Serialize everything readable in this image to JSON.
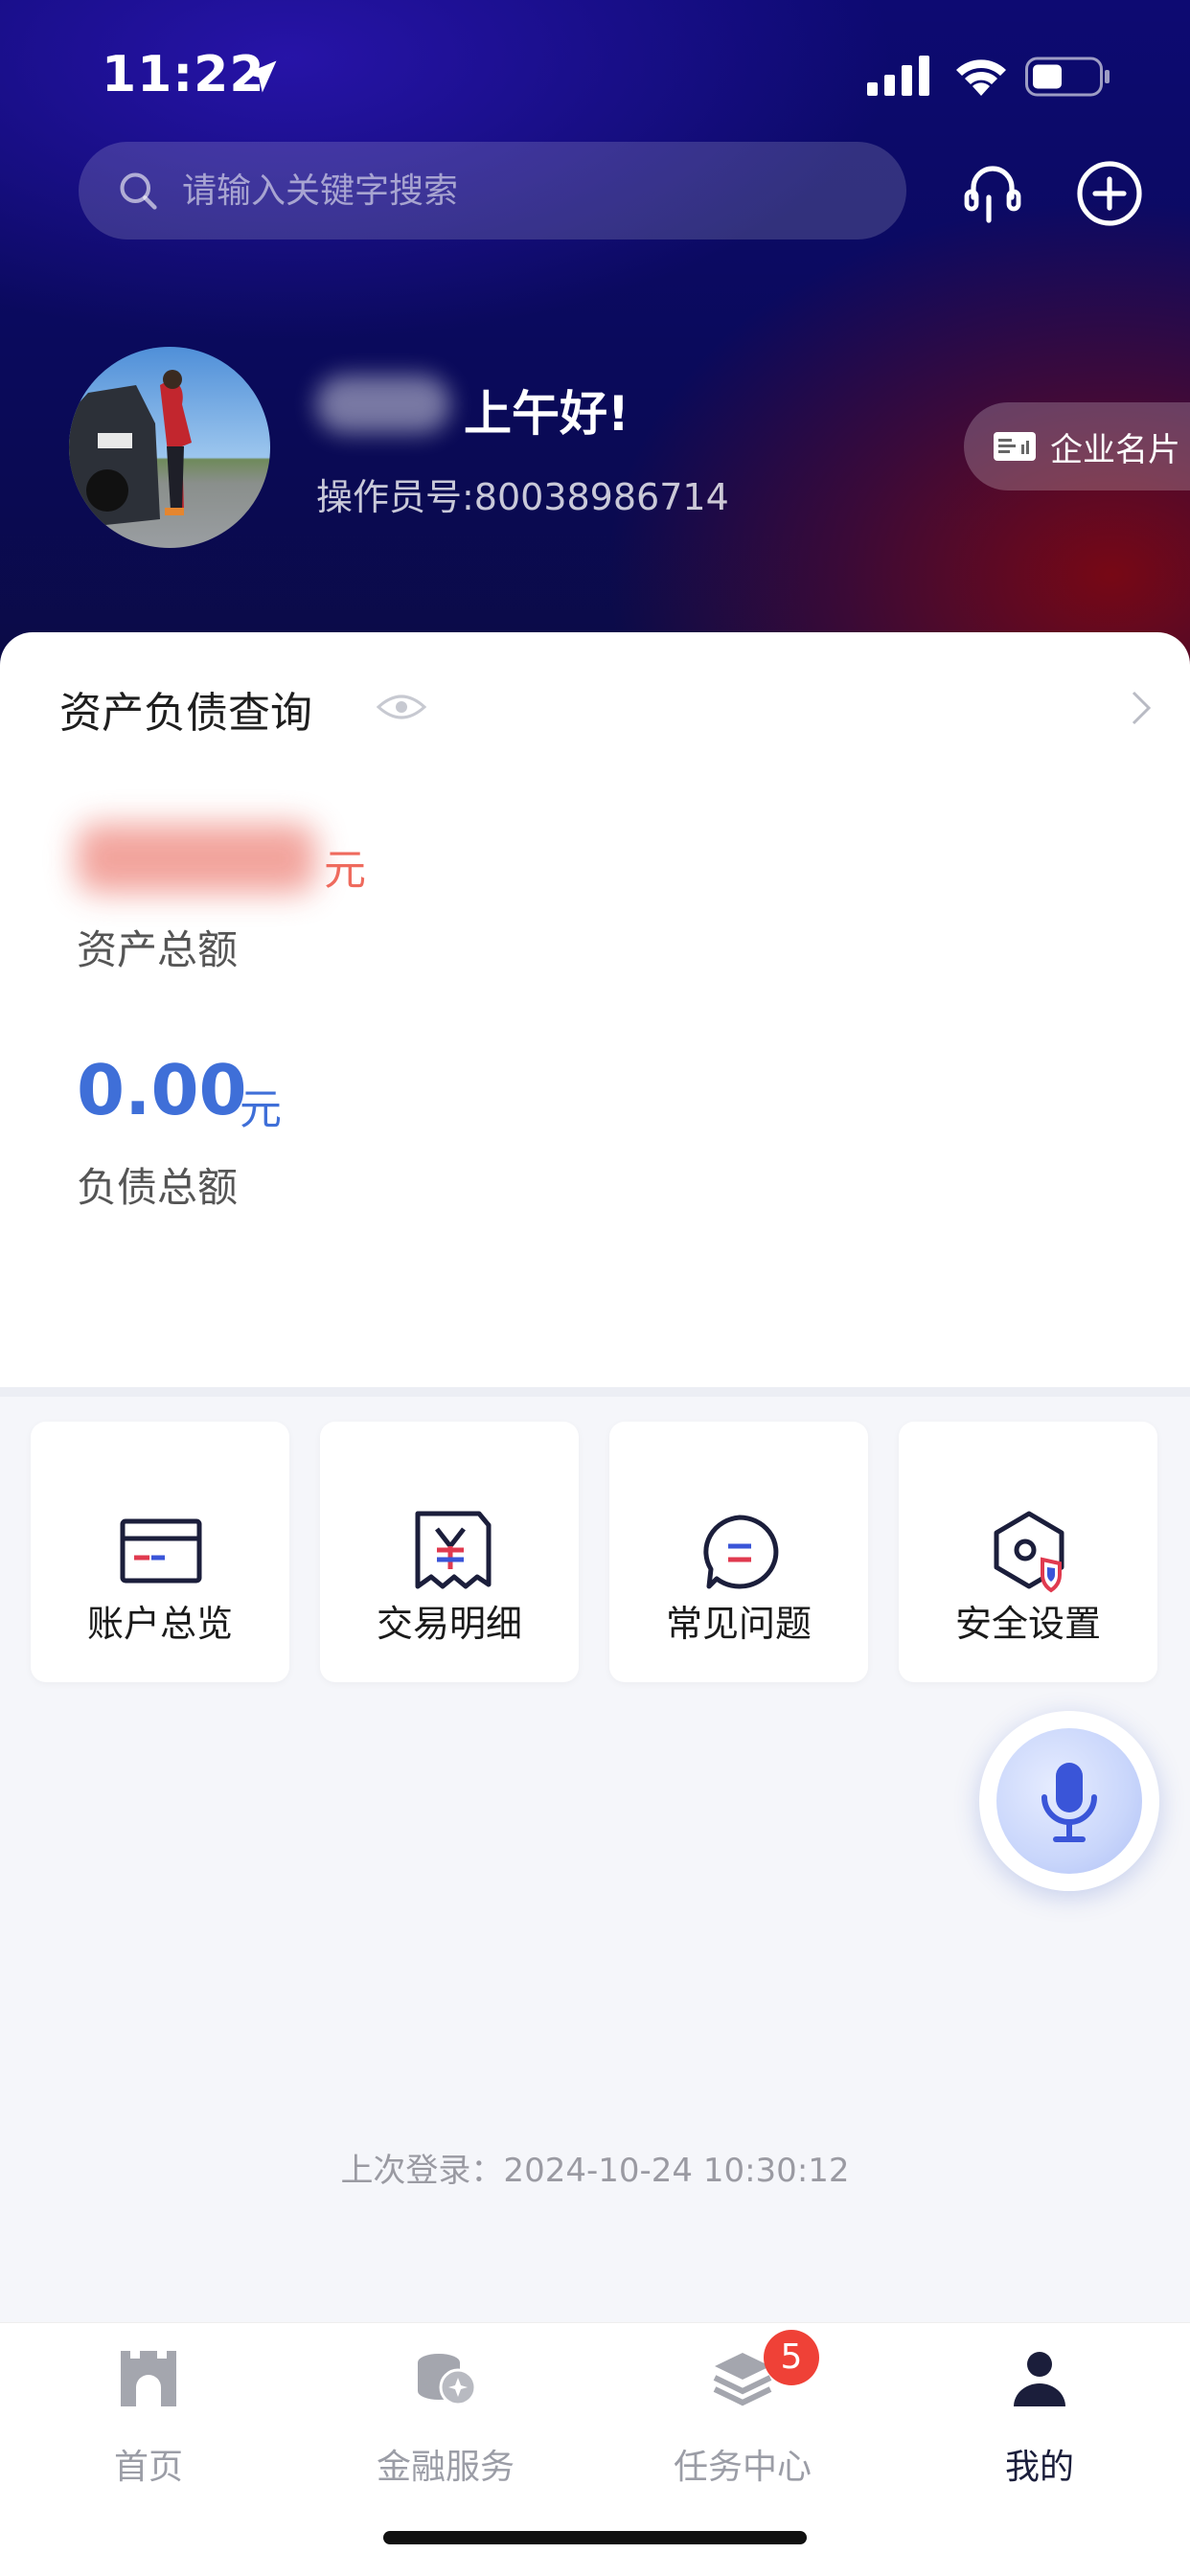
{
  "status_bar": {
    "time": "11:22"
  },
  "search": {
    "placeholder": "请输入关键字搜索"
  },
  "profile": {
    "greeting": "上午好!",
    "operator_id": "操作员号:80038986714",
    "business_card_label": "企业名片"
  },
  "asset_card": {
    "title": "资产负债查询",
    "asset_unit": "元",
    "asset_label": "资产总额",
    "debt_value": "0.00",
    "debt_unit": "元",
    "debt_label": "负债总额"
  },
  "quick_tiles": [
    {
      "label": "账户总览",
      "icon": "card-icon"
    },
    {
      "label": "交易明细",
      "icon": "receipt-yuan-icon"
    },
    {
      "label": "常见问题",
      "icon": "chat-bubble-icon"
    },
    {
      "label": "安全设置",
      "icon": "security-settings-icon"
    }
  ],
  "last_login": "上次登录：2024-10-24 10:30:12",
  "tabbar": {
    "items": [
      {
        "label": "首页",
        "icon": "home-gate-icon",
        "active": false
      },
      {
        "label": "金融服务",
        "icon": "coins-icon",
        "active": false
      },
      {
        "label": "任务中心",
        "icon": "layers-icon",
        "active": false,
        "badge": "5"
      },
      {
        "label": "我的",
        "icon": "person-icon",
        "active": true
      }
    ]
  },
  "colors": {
    "accent_blue": "#3f6fd8",
    "asset_red": "#ef6a5d",
    "badge_red": "#ef4137",
    "header_dark_blue": "#0d0a72",
    "header_dark_red": "#7d0812"
  }
}
